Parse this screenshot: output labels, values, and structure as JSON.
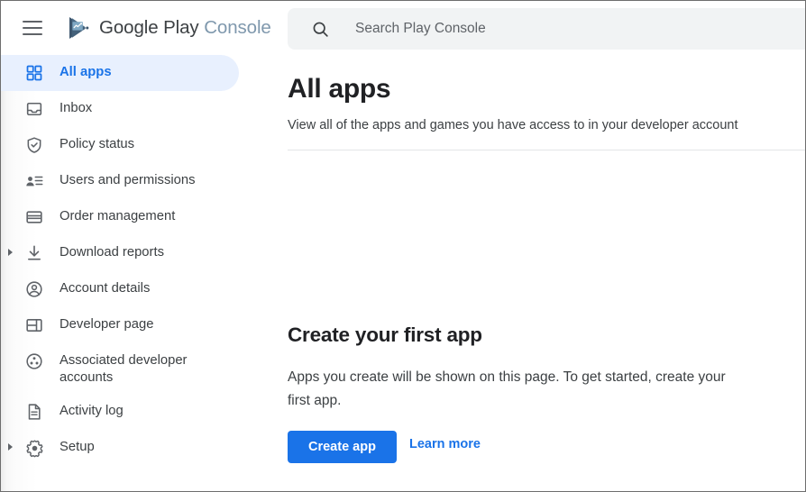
{
  "header": {
    "menu_icon": "hamburger-menu-icon",
    "logo_icon": "google-play-console-logo-icon",
    "brand_primary": "Google Play",
    "brand_secondary": "Console"
  },
  "search": {
    "icon": "search-icon",
    "placeholder": "Search Play Console",
    "value": ""
  },
  "sidebar": {
    "items": [
      {
        "label": "All apps",
        "icon": "grid-apps-icon",
        "active": true,
        "expandable": false
      },
      {
        "label": "Inbox",
        "icon": "inbox-icon",
        "active": false,
        "expandable": false
      },
      {
        "label": "Policy status",
        "icon": "shield-check-icon",
        "active": false,
        "expandable": false
      },
      {
        "label": "Users and permissions",
        "icon": "person-list-icon",
        "active": false,
        "expandable": false
      },
      {
        "label": "Order management",
        "icon": "credit-card-icon",
        "active": false,
        "expandable": false
      },
      {
        "label": "Download reports",
        "icon": "download-icon",
        "active": false,
        "expandable": true
      },
      {
        "label": "Account details",
        "icon": "account-circle-icon",
        "active": false,
        "expandable": false
      },
      {
        "label": "Developer page",
        "icon": "developer-page-icon",
        "active": false,
        "expandable": false
      },
      {
        "label": "Associated developer accounts",
        "icon": "associated-accounts-icon",
        "active": false,
        "expandable": false
      },
      {
        "label": "Activity log",
        "icon": "document-lines-icon",
        "active": false,
        "expandable": false
      },
      {
        "label": "Setup",
        "icon": "gear-icon",
        "active": false,
        "expandable": true
      }
    ]
  },
  "main": {
    "title": "All apps",
    "subtitle": "View all of the apps and games you have access to in your developer account",
    "empty_state": {
      "title": "Create your first app",
      "body": "Apps you create will be shown on this page. To get started, create your first app.",
      "primary_button": "Create app",
      "secondary_link": "Learn more"
    }
  },
  "colors": {
    "accent_blue": "#1a73e8",
    "active_pill": "#e8f0fe",
    "icon_gray": "#5f6368",
    "text_primary": "#202124",
    "text_secondary": "#3c4043",
    "search_bg": "#f1f3f4"
  }
}
